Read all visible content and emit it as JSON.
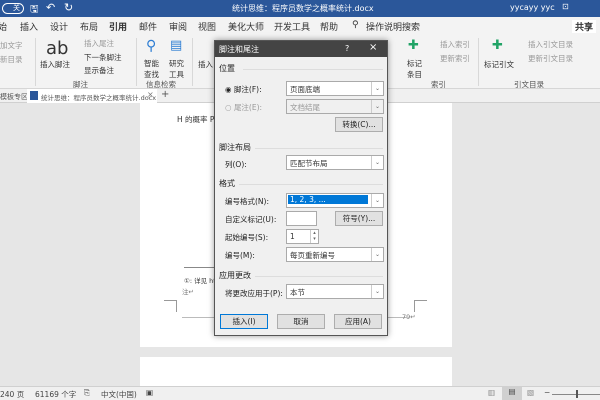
{
  "titlebar": {
    "autosave": "关",
    "doc_title": "统计思维：程序员数学之概率统计.docx",
    "user": "yycayy yyc"
  },
  "tabs": [
    "始",
    "插入",
    "设计",
    "布局",
    "引用",
    "邮件",
    "审阅",
    "视图",
    "美化大师",
    "开发工具",
    "帮助"
  ],
  "active_tab": "引用",
  "search": "操作说明搜索",
  "share": "共享",
  "ribbon": {
    "add_text": "加文字",
    "update_toc": "新目录",
    "insert_footnote": "插入脚注",
    "ab": "ab",
    "insert_endnote": "插入尾注",
    "next_footnote": "下一条脚注",
    "show_notes": "显示备注",
    "footnote_group": "脚注",
    "smart_lookup": "智能查找",
    "research": "研究工具",
    "info_group": "信息检索",
    "insert_citation": "插入",
    "mark_entry": "标记条目",
    "insert_index": "插入索引",
    "update_index": "更新索引",
    "index_group": "索引",
    "mark_citation": "标记引文",
    "insert_toa": "插入引文目录",
    "update_toa": "更新引文目录",
    "toa_group": "引文目录"
  },
  "doctabs": {
    "left": "模板专区",
    "doc": "统计思维：程序员数学之概率统计.docx"
  },
  "page": {
    "text": "H 的概率 P",
    "footnote": "①: 详见 htt",
    "footnote2": "注↵",
    "page_number": "79↵"
  },
  "dialog": {
    "title": "脚注和尾注",
    "help": "?",
    "close": "×",
    "location": "位置",
    "footnote_label": "脚注(F):",
    "footnote_value": "页面底端",
    "endnote_label": "尾注(E):",
    "endnote_value": "文档结尾",
    "convert": "转换(C)...",
    "layout": "脚注布局",
    "columns_label": "列(O):",
    "columns_value": "匹配节布局",
    "format": "格式",
    "number_format_label": "编号格式(N):",
    "number_format_value": "1, 2, 3, ...",
    "custom_mark_label": "自定义标记(U):",
    "custom_mark_value": "",
    "symbol": "符号(Y)...",
    "start_at_label": "起始编号(S):",
    "start_at_value": "1",
    "numbering_label": "编号(M):",
    "numbering_value": "每页重新编号",
    "apply_changes": "应用更改",
    "apply_to_label": "将更改应用于(P):",
    "apply_to_value": "本节",
    "insert": "插入(I)",
    "cancel": "取消",
    "apply": "应用(A)"
  },
  "status": {
    "pages": "240 页",
    "words": "61169 个字",
    "language": "中文(中国)"
  },
  "colors": {
    "brand": "#2b579a",
    "dialog_title": "#444444",
    "selection": "#0078d7"
  }
}
